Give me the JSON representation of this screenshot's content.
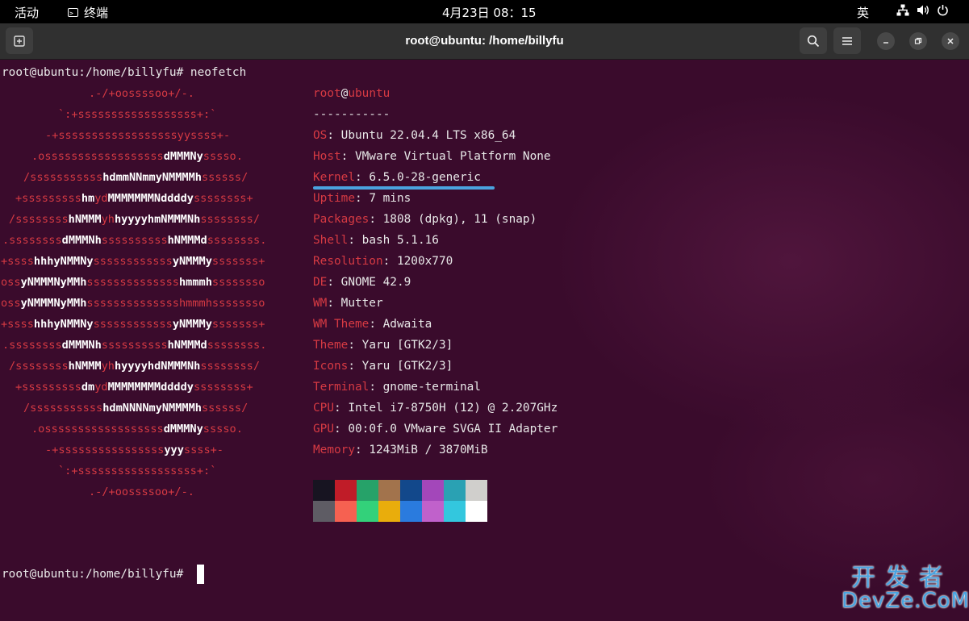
{
  "topbar": {
    "activities": "活动",
    "app_name": "终端",
    "clock": "4月23日  08：15",
    "ime": "英"
  },
  "window": {
    "title": "root@ubuntu: /home/billyfu"
  },
  "terminal": {
    "command_line": "root@ubuntu:/home/billyfu# neofetch",
    "prompt": "root@ubuntu:/home/billyfu# ",
    "art": [
      [
        [
          "         .-/+oossssoo+/-.",
          ""
        ]
      ],
      [
        [
          "     `:+ssssssssssssssssss+:`",
          ""
        ]
      ],
      [
        [
          "   -+ssssssssssssssssssyyssss+-",
          ""
        ]
      ],
      [
        [
          "  .ossssssssssssssssss",
          ""
        ],
        [
          "dMMMNy",
          "b"
        ],
        [
          "sssso.",
          ""
        ]
      ],
      [
        [
          " /sssssssssss",
          ""
        ],
        [
          "hdmmNNmmyNMMMMh",
          "b"
        ],
        [
          "ssssss/",
          ""
        ]
      ],
      [
        [
          "+sssssssss",
          ""
        ],
        [
          "hm",
          "b"
        ],
        [
          "yd",
          ""
        ],
        [
          "MMMMMMMNddddy",
          "b"
        ],
        [
          "ssssssss+",
          ""
        ]
      ]
    ],
    "art_rows": [
      [
        [
          "/ssssssss",
          ""
        ],
        [
          "hNMMM",
          "b"
        ],
        [
          "yh",
          ""
        ],
        [
          "hyyyyhmNMMMNh",
          "b"
        ],
        [
          "ssssssss/",
          ""
        ]
      ],
      [
        [
          ".ssssssss",
          ""
        ],
        [
          "dMMMNh",
          "b"
        ],
        [
          "ssssssssss",
          ""
        ],
        [
          "hNMMMd",
          "b"
        ],
        [
          "ssssssss.",
          ""
        ]
      ],
      [
        [
          "+ssss",
          ""
        ],
        [
          "hhhyNMMNy",
          "b"
        ],
        [
          "ssssssssssss",
          ""
        ],
        [
          "yNMMMy",
          "b"
        ],
        [
          "sssssss+",
          ""
        ]
      ],
      [
        [
          "oss",
          ""
        ],
        [
          "yNMMMNyMMh",
          "b"
        ],
        [
          "ssssssssssssss",
          ""
        ],
        [
          "hmmmh",
          "b"
        ],
        [
          "ssssssso",
          ""
        ]
      ],
      [
        [
          "oss",
          ""
        ],
        [
          "yNMMMNyMMh",
          "b"
        ],
        [
          "sssssssssssssshmmmhssssssso",
          ""
        ]
      ],
      [
        [
          "+ssss",
          ""
        ],
        [
          "hhhyNMMNy",
          "b"
        ],
        [
          "ssssssssssss",
          ""
        ],
        [
          "yNMMMy",
          "b"
        ],
        [
          "sssssss+",
          ""
        ]
      ],
      [
        [
          ".ssssssss",
          ""
        ],
        [
          "dMMMNh",
          "b"
        ],
        [
          "ssssssssss",
          ""
        ],
        [
          "hNMMMd",
          "b"
        ],
        [
          "ssssssss.",
          ""
        ]
      ],
      [
        [
          " /ssssssss",
          ""
        ],
        [
          "hNMMM",
          "b"
        ],
        [
          "yh",
          ""
        ],
        [
          "hyyyyhdNMMMNh",
          "b"
        ],
        [
          "ssssssss/",
          ""
        ]
      ],
      [
        [
          "  +sssssssss",
          ""
        ],
        [
          "dm",
          "b"
        ],
        [
          "yd",
          ""
        ],
        [
          "MMMMMMMMddddy",
          "b"
        ],
        [
          "ssssssss+",
          ""
        ]
      ],
      [
        [
          "   /sssssssssss",
          ""
        ],
        [
          "hdmNNNNmyNMMMMh",
          "b"
        ],
        [
          "ssssss/",
          ""
        ]
      ],
      [
        [
          "    .ossssssssssssssssss",
          ""
        ],
        [
          "dMMMNy",
          "b"
        ],
        [
          "sssso.",
          ""
        ]
      ],
      [
        [
          "      -+ssssssssssssssss",
          ""
        ],
        [
          "yyy",
          "b"
        ],
        [
          "ssss+-",
          ""
        ]
      ],
      [
        [
          "        `:+ssssssssssssssssss+:`",
          ""
        ]
      ],
      [
        [
          "            .-/+oossssoo+/-.",
          ""
        ]
      ]
    ],
    "user": "root",
    "host": "ubuntu",
    "separator": "-----------",
    "info": [
      {
        "key": "OS",
        "value": "Ubuntu 22.04.4 LTS x86_64"
      },
      {
        "key": "Host",
        "value": "VMware Virtual Platform None"
      },
      {
        "key": "Kernel",
        "value": "6.5.0-28-generic"
      },
      {
        "key": "Uptime",
        "value": "7 mins"
      },
      {
        "key": "Packages",
        "value": "1808 (dpkg), 11 (snap)"
      },
      {
        "key": "Shell",
        "value": "bash 5.1.16"
      },
      {
        "key": "Resolution",
        "value": "1200x770"
      },
      {
        "key": "DE",
        "value": "GNOME 42.9"
      },
      {
        "key": "WM",
        "value": "Mutter"
      },
      {
        "key": "WM Theme",
        "value": "Adwaita"
      },
      {
        "key": "Theme",
        "value": "Yaru [GTK2/3]"
      },
      {
        "key": "Icons",
        "value": "Yaru [GTK2/3]"
      },
      {
        "key": "Terminal",
        "value": "gnome-terminal"
      },
      {
        "key": "CPU",
        "value": "Intel i7-8750H (12) @ 2.207GHz"
      },
      {
        "key": "GPU",
        "value": "00:0f.0 VMware SVGA II Adapter"
      },
      {
        "key": "Memory",
        "value": "1243MiB / 3870MiB"
      }
    ],
    "palette_top": [
      "#171421",
      "#c01c28",
      "#26a269",
      "#a2734c",
      "#12488b",
      "#a347ba",
      "#2aa1b3",
      "#d0cfcc"
    ],
    "palette_bottom": [
      "#5e5c64",
      "#f66151",
      "#33d17a",
      "#e9ad0c",
      "#2a7bde",
      "#c061cb",
      "#33c7de",
      "#ffffff"
    ],
    "colors": {
      "key": "#d63a43",
      "highlight": "#4aa3df"
    }
  },
  "watermark": {
    "cn": "开发者",
    "en": "DevZe.CoM"
  }
}
